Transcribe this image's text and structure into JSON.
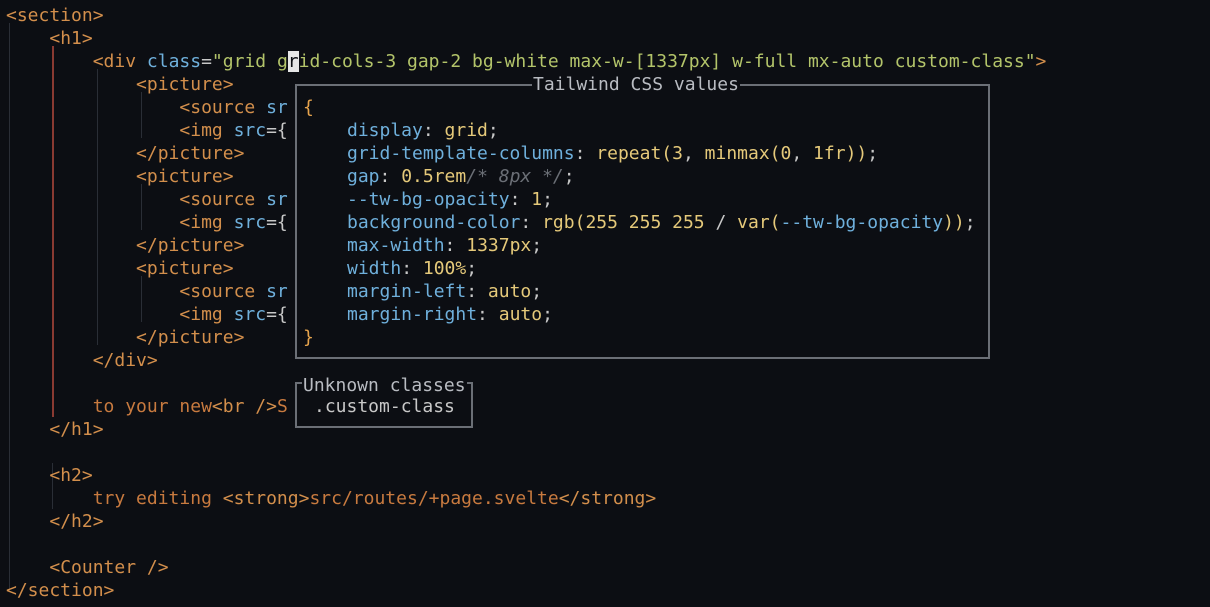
{
  "editor": {
    "lines": [
      {
        "indent": "",
        "segments": [
          {
            "t": "<section>",
            "c": "tag"
          }
        ]
      },
      {
        "indent": "    ",
        "segments": [
          {
            "t": "<h1>",
            "c": "tag"
          }
        ]
      },
      {
        "indent": "        ",
        "segments": [
          {
            "t": "<div ",
            "c": "tag"
          },
          {
            "t": "class",
            "c": "attr"
          },
          {
            "t": "=",
            "c": "punc"
          },
          {
            "t": "\"grid g",
            "c": "str"
          },
          {
            "t": "r",
            "c": "cursor"
          },
          {
            "t": "id-cols-3 gap-2 bg-white max-w-[1337px] w-full mx-auto custom-class\"",
            "c": "str"
          },
          {
            "t": ">",
            "c": "tag"
          }
        ]
      },
      {
        "indent": "            ",
        "segments": [
          {
            "t": "<picture>",
            "c": "tag"
          }
        ]
      },
      {
        "indent": "                ",
        "segments": [
          {
            "t": "<source ",
            "c": "tag"
          },
          {
            "t": "sr",
            "c": "attr"
          }
        ]
      },
      {
        "indent": "                ",
        "segments": [
          {
            "t": "<img ",
            "c": "tag"
          },
          {
            "t": "src",
            "c": "attr"
          },
          {
            "t": "={",
            "c": "punc"
          }
        ]
      },
      {
        "indent": "            ",
        "segments": [
          {
            "t": "</picture>",
            "c": "tag"
          }
        ]
      },
      {
        "indent": "            ",
        "segments": [
          {
            "t": "<picture>",
            "c": "tag"
          }
        ]
      },
      {
        "indent": "                ",
        "segments": [
          {
            "t": "<source ",
            "c": "tag"
          },
          {
            "t": "sr",
            "c": "attr"
          }
        ]
      },
      {
        "indent": "                ",
        "segments": [
          {
            "t": "<img ",
            "c": "tag"
          },
          {
            "t": "src",
            "c": "attr"
          },
          {
            "t": "={",
            "c": "punc"
          }
        ]
      },
      {
        "indent": "            ",
        "segments": [
          {
            "t": "</picture>",
            "c": "tag"
          }
        ]
      },
      {
        "indent": "            ",
        "segments": [
          {
            "t": "<picture>",
            "c": "tag"
          }
        ]
      },
      {
        "indent": "                ",
        "segments": [
          {
            "t": "<source ",
            "c": "tag"
          },
          {
            "t": "sr",
            "c": "attr"
          }
        ]
      },
      {
        "indent": "                ",
        "segments": [
          {
            "t": "<img ",
            "c": "tag"
          },
          {
            "t": "src",
            "c": "attr"
          },
          {
            "t": "={",
            "c": "punc"
          }
        ]
      },
      {
        "indent": "            ",
        "segments": [
          {
            "t": "</picture>",
            "c": "tag"
          }
        ]
      },
      {
        "indent": "        ",
        "segments": [
          {
            "t": "</div>",
            "c": "tag"
          }
        ]
      },
      {
        "indent": "",
        "segments": []
      },
      {
        "indent": "        ",
        "segments": [
          {
            "t": "to your new",
            "c": "txt"
          },
          {
            "t": "<br />",
            "c": "tag"
          },
          {
            "t": "S",
            "c": "txt"
          }
        ]
      },
      {
        "indent": "    ",
        "segments": [
          {
            "t": "</h1>",
            "c": "tag"
          }
        ]
      },
      {
        "indent": "",
        "segments": []
      },
      {
        "indent": "    ",
        "segments": [
          {
            "t": "<h2>",
            "c": "tag"
          }
        ]
      },
      {
        "indent": "        ",
        "segments": [
          {
            "t": "try editing ",
            "c": "txt"
          },
          {
            "t": "<strong>",
            "c": "tag"
          },
          {
            "t": "src/routes/+page.svelte",
            "c": "txt"
          },
          {
            "t": "</strong>",
            "c": "tag"
          }
        ]
      },
      {
        "indent": "    ",
        "segments": [
          {
            "t": "</h2>",
            "c": "tag"
          }
        ]
      },
      {
        "indent": "",
        "segments": []
      },
      {
        "indent": "    ",
        "segments": [
          {
            "t": "<Counter />",
            "c": "tag"
          }
        ]
      },
      {
        "indent": "",
        "segments": [
          {
            "t": "</section>",
            "c": "tag"
          }
        ]
      }
    ]
  },
  "tailwind_popup": {
    "title": "Tailwind CSS values",
    "open_brace": "{",
    "close_brace": "}",
    "declarations": [
      {
        "prop": "display",
        "value": [
          {
            "t": "grid",
            "c": "val"
          }
        ]
      },
      {
        "prop": "grid-template-columns",
        "value": [
          {
            "t": "repeat(",
            "c": "fn"
          },
          {
            "t": "3",
            "c": "num"
          },
          {
            "t": ", ",
            "c": "plain"
          },
          {
            "t": "minmax(",
            "c": "fn"
          },
          {
            "t": "0",
            "c": "num"
          },
          {
            "t": ", ",
            "c": "plain"
          },
          {
            "t": "1fr",
            "c": "num"
          },
          {
            "t": "))",
            "c": "fn"
          }
        ]
      },
      {
        "prop": "gap",
        "value": [
          {
            "t": "0.5rem",
            "c": "num"
          },
          {
            "t": "/* 8px */",
            "c": "cmt"
          }
        ]
      },
      {
        "prop": "--tw-bg-opacity",
        "value": [
          {
            "t": "1",
            "c": "num"
          }
        ]
      },
      {
        "prop": "background-color",
        "value": [
          {
            "t": "rgb(",
            "c": "fn"
          },
          {
            "t": "255 255 255",
            "c": "num"
          },
          {
            "t": " / ",
            "c": "plain"
          },
          {
            "t": "var(",
            "c": "fn"
          },
          {
            "t": "--tw-bg-opacity",
            "c": "prop"
          },
          {
            "t": "))",
            "c": "fn"
          }
        ]
      },
      {
        "prop": "max-width",
        "value": [
          {
            "t": "1337px",
            "c": "num"
          }
        ]
      },
      {
        "prop": "width",
        "value": [
          {
            "t": "100%",
            "c": "num"
          }
        ]
      },
      {
        "prop": "margin-left",
        "value": [
          {
            "t": "auto",
            "c": "val"
          }
        ]
      },
      {
        "prop": "margin-right",
        "value": [
          {
            "t": "auto",
            "c": "val"
          }
        ]
      }
    ]
  },
  "unknown_popup": {
    "title": "Unknown classes",
    "items": [
      ".custom-class"
    ]
  }
}
